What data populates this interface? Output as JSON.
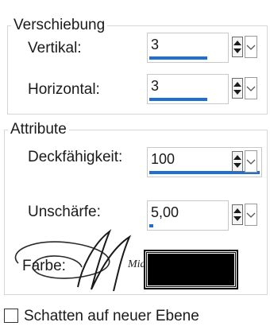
{
  "group_shift": {
    "legend": "Verschiebung",
    "vertical": {
      "label": "Vertikal:",
      "value": "3",
      "fill": 0.75
    },
    "horizontal": {
      "label": "Horizontal:",
      "value": "3",
      "fill": 0.75
    }
  },
  "group_attributes": {
    "legend": "Attribute",
    "opacity": {
      "label": "Deckfähigkeit:",
      "value": "100",
      "fill": 1.0
    },
    "blur": {
      "label": "Unschärfe:",
      "value": "5,00",
      "fill": 0.05
    },
    "color": {
      "label": "Farbe:",
      "value_hex": "#000000"
    }
  },
  "checkbox_new_layer": {
    "label": "Schatten auf neuer Ebene",
    "checked": false
  },
  "watermark_text": "Mia",
  "colors": {
    "accent": "#1e6fd0",
    "border": "#d6d6d6"
  },
  "icons": {
    "spinner": "up-down-arrows-icon",
    "dropdown": "chevron-down-icon"
  }
}
